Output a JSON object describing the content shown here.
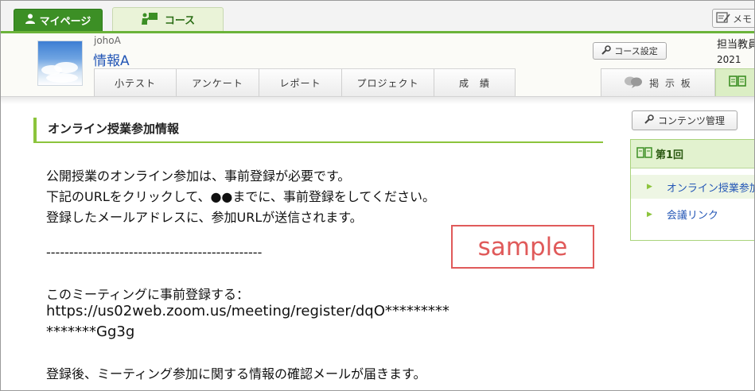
{
  "tabs": {
    "mypage": "マイページ",
    "course": "コース",
    "memo": "メモ"
  },
  "course": {
    "code": "johoA",
    "name": "情報A",
    "setting_button": "コース設定",
    "teacher_label": "担当教員",
    "year": "2021"
  },
  "subnav": [
    "小テスト",
    "アンケート",
    "レポート",
    "プロジェクト",
    "成　績"
  ],
  "board_tab": "掲 示 板",
  "section_title": "オンライン授業参加情報",
  "body": {
    "line1": "公開授業のオンライン参加は、事前登録が必要です。",
    "line2": "下記のURLをクリックして、●●までに、事前登録をしてください。",
    "line3": "登録したメールアドレスに、参加URLが送信されます。",
    "divider": "-----------------------------------------------",
    "register_label": "このミーティングに事前登録する：",
    "url_line1": "https://us02web.zoom.us/meeting/register/dqO*********",
    "url_line2": "*******Gg3g",
    "after_note": "登録後、ミーティング参加に関する情報の確認メールが届きます。"
  },
  "stamp": "sample",
  "sidebar": {
    "contents_button": "コンテンツ管理",
    "week_title": "第1回",
    "items": [
      "オンライン授業参加情報",
      "会議リンク"
    ]
  },
  "colors": {
    "accent_green": "#3c8f25",
    "link_blue": "#2457b6",
    "stamp_red": "#e05a5a"
  }
}
